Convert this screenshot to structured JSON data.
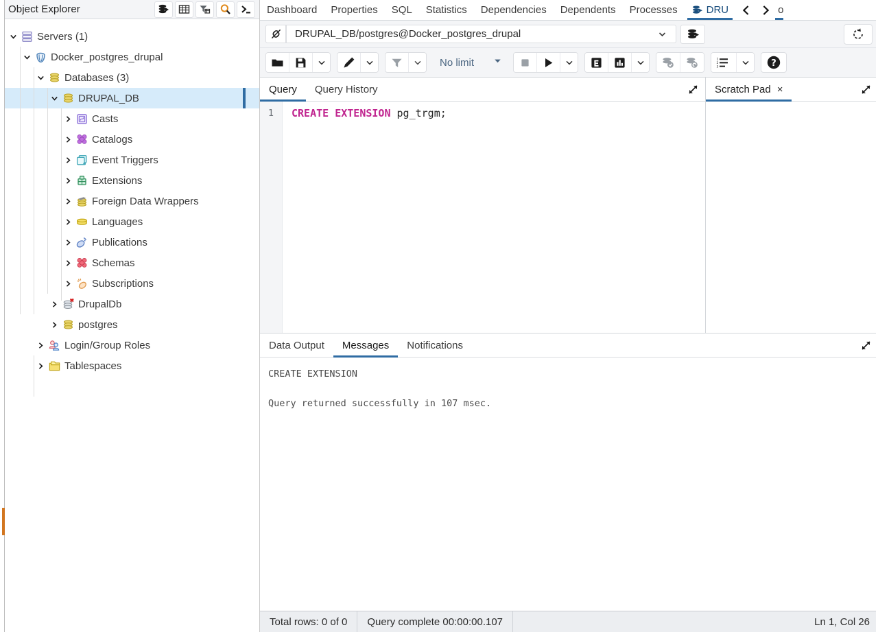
{
  "explorer": {
    "title": "Object Explorer",
    "toolbar": [
      {
        "name": "object-explorer-toggle-icon",
        "icon": "database-stack-icon"
      },
      {
        "name": "grid-view-icon",
        "icon": "table-grid-icon"
      },
      {
        "name": "filter-rows-icon",
        "icon": "funnel-table-icon"
      },
      {
        "name": "search-objects-icon",
        "icon": "search-icon"
      },
      {
        "name": "psql-tool-icon",
        "icon": "terminal-icon"
      }
    ],
    "tree": [
      {
        "label": "Servers (1)",
        "depth": 0,
        "state": "expanded",
        "icon": "servers-icon",
        "selected": false
      },
      {
        "label": "Docker_postgres_drupal",
        "depth": 1,
        "state": "expanded",
        "icon": "postgres-server-icon",
        "selected": false
      },
      {
        "label": "Databases (3)",
        "depth": 2,
        "state": "expanded",
        "icon": "databases-icon",
        "selected": false
      },
      {
        "label": "DRUPAL_DB",
        "depth": 3,
        "state": "expanded",
        "icon": "database-icon",
        "selected": true
      },
      {
        "label": "Casts",
        "depth": 4,
        "state": "collapsed",
        "icon": "casts-icon",
        "selected": false
      },
      {
        "label": "Catalogs",
        "depth": 4,
        "state": "collapsed",
        "icon": "catalogs-icon",
        "selected": false
      },
      {
        "label": "Event Triggers",
        "depth": 4,
        "state": "collapsed",
        "icon": "event-triggers-icon",
        "selected": false
      },
      {
        "label": "Extensions",
        "depth": 4,
        "state": "collapsed",
        "icon": "extensions-icon",
        "selected": false
      },
      {
        "label": "Foreign Data Wrappers",
        "depth": 4,
        "state": "collapsed",
        "icon": "foreign-data-wrappers-icon",
        "selected": false
      },
      {
        "label": "Languages",
        "depth": 4,
        "state": "collapsed",
        "icon": "languages-icon",
        "selected": false
      },
      {
        "label": "Publications",
        "depth": 4,
        "state": "collapsed",
        "icon": "publications-icon",
        "selected": false
      },
      {
        "label": "Schemas",
        "depth": 4,
        "state": "collapsed",
        "icon": "schemas-icon",
        "selected": false
      },
      {
        "label": "Subscriptions",
        "depth": 4,
        "state": "collapsed",
        "icon": "subscriptions-icon",
        "selected": false
      },
      {
        "label": "DrupalDb",
        "depth": 3,
        "state": "collapsed",
        "icon": "database-disconnected-icon",
        "selected": false
      },
      {
        "label": "postgres",
        "depth": 3,
        "state": "collapsed",
        "icon": "database-icon",
        "selected": false
      },
      {
        "label": "Login/Group Roles",
        "depth": 2,
        "state": "collapsed",
        "icon": "login-group-roles-icon",
        "selected": false
      },
      {
        "label": "Tablespaces",
        "depth": 2,
        "state": "collapsed",
        "icon": "tablespaces-icon",
        "selected": false
      }
    ]
  },
  "object_tabs": {
    "items": [
      {
        "label": "Dashboard",
        "active": false
      },
      {
        "label": "Properties",
        "active": false
      },
      {
        "label": "SQL",
        "active": false
      },
      {
        "label": "Statistics",
        "active": false
      },
      {
        "label": "Dependencies",
        "active": false
      },
      {
        "label": "Dependents",
        "active": false
      },
      {
        "label": "Processes",
        "active": false
      }
    ],
    "query_tab": {
      "label": "DRU",
      "icon": "query-tool-icon",
      "active": true
    },
    "nav_prev": "‹",
    "nav_next": "›",
    "overflow_tab": {
      "label": "o",
      "active": true
    }
  },
  "connection": {
    "icon": "connection-broken-icon",
    "value": "DRUPAL_DB/postgres@Docker_postgres_drupal",
    "caret": "chevron-down-icon",
    "db_button_icon": "database-stack-icon",
    "refresh_icon": "reset-icon"
  },
  "query_toolbar": {
    "open_file_icon": "folder-open-icon",
    "save_file_icon": "save-floppy-icon",
    "save_caret_icon": "chevron-down-icon",
    "edit_icon": "pencil-icon",
    "edit_caret_icon": "chevron-down-icon",
    "filter_icon": "funnel-icon",
    "filter_caret_icon": "chevron-down-icon",
    "limit_label": "No limit",
    "limit_caret_icon": "caret-down-solid-icon",
    "stop_icon": "stop-square-icon",
    "execute_icon": "play-triangle-icon",
    "execute_caret_icon": "chevron-down-icon",
    "explain_icon": "explain-e-icon",
    "explain_analyze_icon": "explain-analyze-bars-icon",
    "explain_caret_icon": "chevron-down-icon",
    "commit_icon": "commit-check-icon",
    "rollback_icon": "rollback-icon",
    "macros_icon": "numbered-list-icon",
    "macros_caret_icon": "chevron-down-icon",
    "help_icon": "help-question-icon"
  },
  "editor": {
    "tabs": [
      {
        "label": "Query",
        "active": true
      },
      {
        "label": "Query History",
        "active": false
      }
    ],
    "expand_icon": "expand-diagonal-icon",
    "lines": [
      {
        "number": "1",
        "tokens": [
          {
            "text": "CREATE EXTENSION",
            "type": "keyword"
          },
          {
            "text": " pg_trgm;",
            "type": "identifier"
          }
        ]
      }
    ]
  },
  "scratch_pad": {
    "tab_label": "Scratch Pad",
    "close_icon": "×",
    "expand_icon": "expand-diagonal-icon",
    "content": ""
  },
  "output": {
    "tabs": [
      {
        "label": "Data Output",
        "active": false
      },
      {
        "label": "Messages",
        "active": true
      },
      {
        "label": "Notifications",
        "active": false
      }
    ],
    "expand_icon": "expand-diagonal-icon",
    "messages": [
      "CREATE EXTENSION",
      "",
      "Query returned successfully in 107 msec."
    ]
  },
  "status_bar": {
    "total_rows": "Total rows: 0 of 0",
    "query_complete": "Query complete 00:00:00.107",
    "cursor_position": "Ln 1, Col 26"
  },
  "colors": {
    "accent": "#2f6ca3",
    "selected_row": "#d6ebfa",
    "toolbar_bg": "#f4f5f7",
    "status_bg": "#eceef1",
    "keyword": "#c0248f",
    "left_marker": "#d2761f",
    "search_icon": "#e08a1e"
  }
}
